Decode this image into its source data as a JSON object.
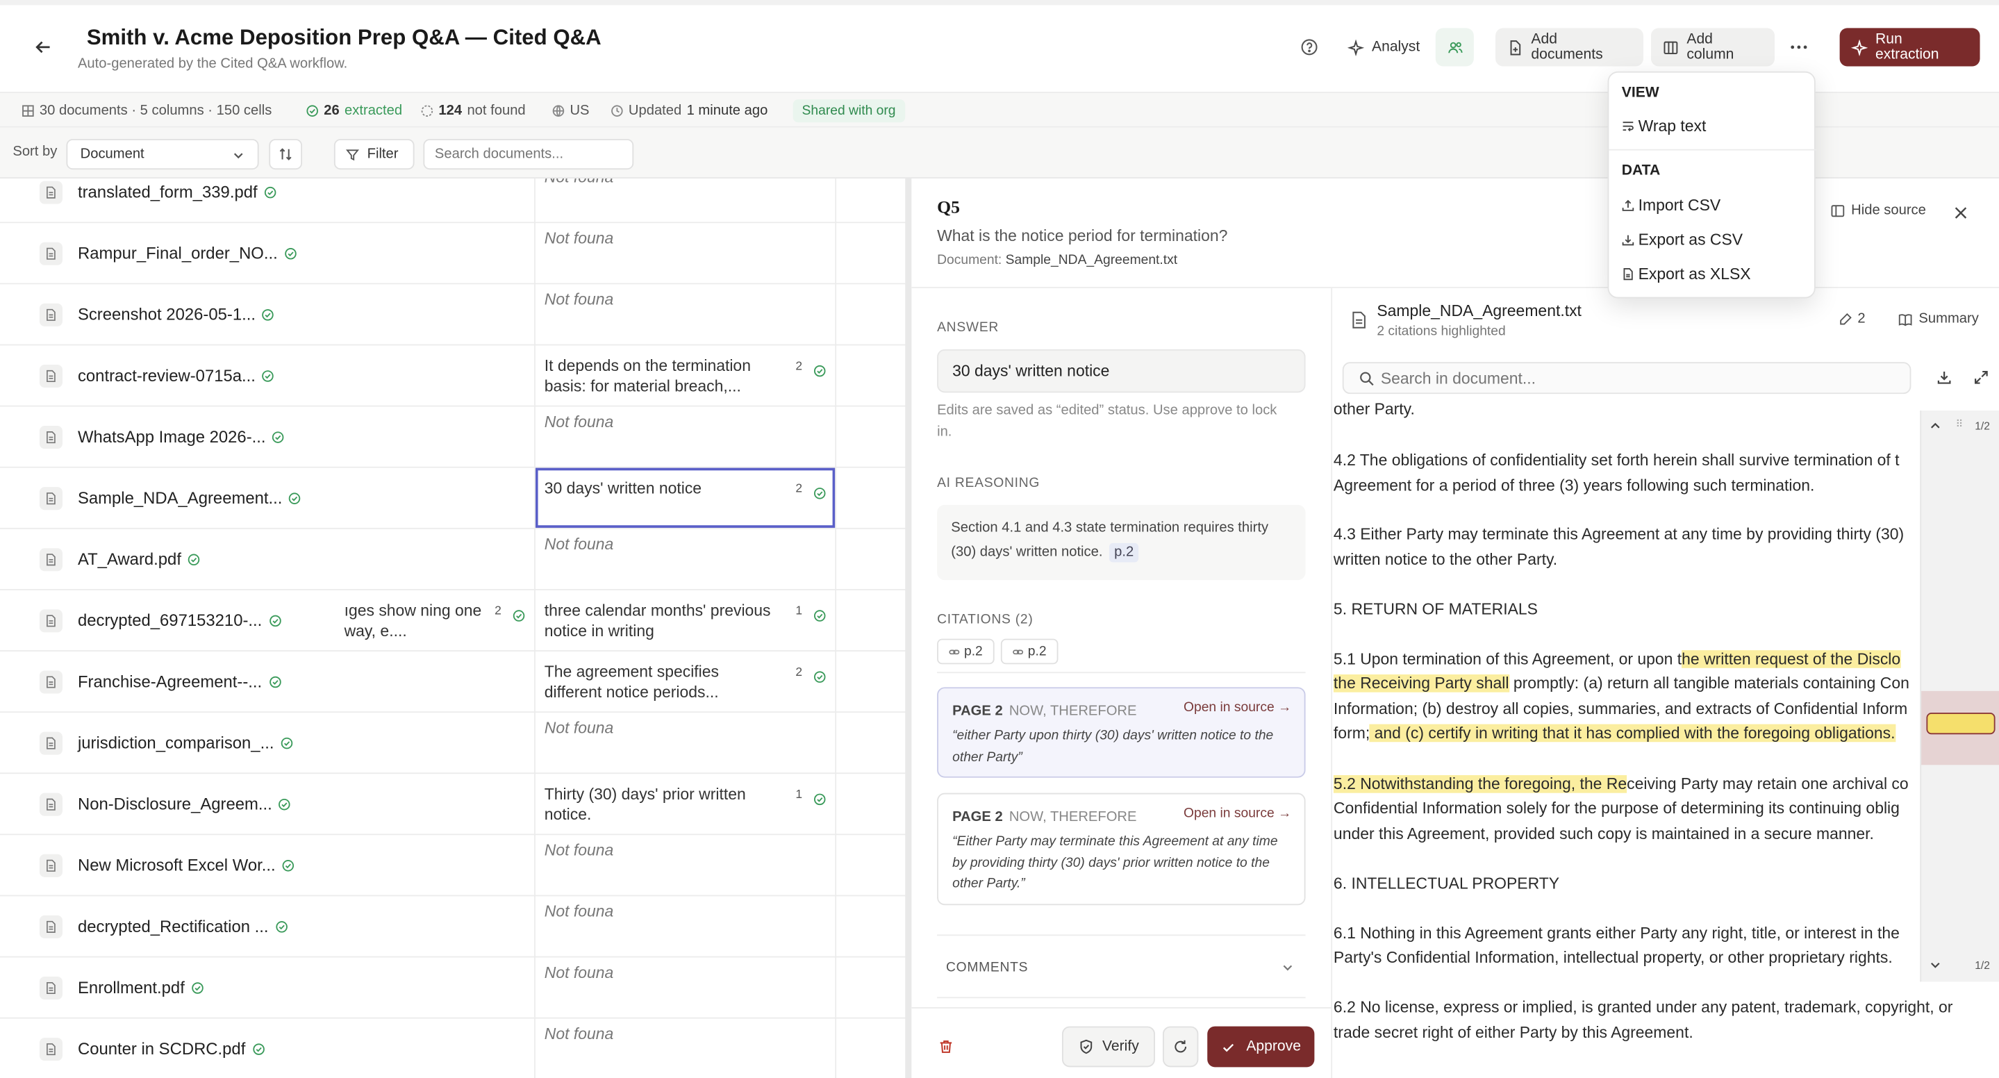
{
  "header": {
    "title": "Smith v. Acme Deposition Prep Q&A — Cited Q&A",
    "subtitle": "Auto-generated by the Cited Q&A workflow.",
    "analyst_label": "Analyst",
    "add_documents_label": "Add documents",
    "add_column_label": "Add column",
    "run_label": "Run extraction"
  },
  "meta": {
    "documents": "30 documents · 5 columns · 150 cells",
    "extracted_count": "26",
    "extracted_label": "extracted",
    "notfound_count": "124",
    "notfound_label": "not found",
    "region": "US",
    "updated_prefix": "Updated",
    "updated_value": "1 minute ago",
    "shared": "Shared with org"
  },
  "sortbar": {
    "sort_label": "Sort by",
    "sort_value": "Document",
    "filter_label": "Filter",
    "search_placeholder": "Search documents..."
  },
  "rows": [
    {
      "name": "translated_form_339.pdf",
      "cell": "Not founa",
      "nf": true
    },
    {
      "name": "Rampur_Final_order_NO...",
      "cell": "Not founa",
      "nf": true
    },
    {
      "name": "Screenshot 2026-05-1...",
      "cell": "Not founa",
      "nf": true
    },
    {
      "name": "contract-review-0715a...",
      "cell": "It depends on the termination basis: for material breach,...",
      "nf": false,
      "count": "2"
    },
    {
      "name": "WhatsApp Image 2026-...",
      "cell": "Not founa",
      "nf": true
    },
    {
      "name": "Sample_NDA_Agreement...",
      "cell": "30 days' written notice",
      "nf": false,
      "count": "2",
      "selected": true
    },
    {
      "name": "AT_Award.pdf",
      "cell": "Not founa",
      "nf": true
    },
    {
      "name": "decrypted_697153210-...",
      "cell": "three calendar months' previous notice in writing",
      "nf": false,
      "count": "1",
      "prev": "ıges show ning one way, e....",
      "prevcount": "2"
    },
    {
      "name": "Franchise-Agreement--...",
      "cell": "The agreement specifies different notice periods...",
      "nf": false,
      "count": "2"
    },
    {
      "name": "jurisdiction_comparison_...",
      "cell": "Not founa",
      "nf": true
    },
    {
      "name": "Non-Disclosure_Agreem...",
      "cell": "Thirty (30) days' prior written notice.",
      "nf": false,
      "count": "1"
    },
    {
      "name": "New Microsoft Excel Wor...",
      "cell": "Not founa",
      "nf": true
    },
    {
      "name": "decrypted_Rectification ...",
      "cell": "Not founa",
      "nf": true
    },
    {
      "name": "Enrollment.pdf",
      "cell": "Not founa",
      "nf": true
    },
    {
      "name": "Counter in SCDRC.pdf",
      "cell": "Not founa",
      "nf": true
    }
  ],
  "panel": {
    "qid": "Q5",
    "question": "What is the notice period for termination?",
    "doc_prefix": "Document:",
    "doc_name": "Sample_NDA_Agreement.txt",
    "hide_source": "Hide source",
    "answer_label": "ANSWER",
    "answer": "30 days' written notice",
    "answer_hint": "Edits are saved as “edited” status. Use approve to lock in.",
    "reasoning_label": "AI REASONING",
    "reasoning": "Section 4.1 and 4.3 state termination requires thirty (30) days' written notice.",
    "reasoning_ref": "p.2",
    "citations_label": "CITATIONS (2)",
    "chips": [
      "p.2",
      "p.2"
    ],
    "citations": [
      {
        "page": "PAGE 2",
        "section": "NOW, THEREFORE",
        "open": "Open in source →",
        "quote": "“either Party upon thirty (30) days' written notice to the other Party”"
      },
      {
        "page": "PAGE 2",
        "section": "NOW, THEREFORE",
        "open": "Open in source →",
        "quote": "“Either Party may terminate this Agreement at any time by providing thirty (30) days' prior written notice to the other Party.”"
      }
    ],
    "comments_label": "COMMENTS",
    "verify": "Verify",
    "approve": "Approve"
  },
  "viewer": {
    "filename": "Sample_NDA_Agreement.txt",
    "subtitle": "2 citations highlighted",
    "cite_count": "2",
    "summary": "Summary",
    "search_placeholder": "Search in document...",
    "page_top": "1/2",
    "page_bottom": "1/2",
    "lines": {
      "l0": "other Party.",
      "l1": "4.2 The obligations of confidentiality set forth herein shall survive termination of t",
      "l2": "Agreement for a period of three (3) years following such termination.",
      "l3": "4.3 Either Party may terminate this Agreement at any time by providing thirty (30)",
      "l4": "written notice to the other Party.",
      "l5": "5. RETURN OF MATERIALS",
      "l6a": "5.1 Upon termination of this Agreement, or upon t",
      "l6b": "he written request of the Disclo",
      "l7a": "the Receiving Party shall",
      "l7b": " promptly: (a) return all tangible materials containing Con",
      "l8": "Information; (b) destroy all copies, summaries, and extracts of Confidential Inform",
      "l9a": "form;",
      "l9b": " and (c) certify in writing that it has complied with the foregoing obligations.",
      "l10a": "5.2 Notwithstanding the foregoing, the Re",
      "l10b": "ceiving Party may retain one archival co",
      "l11": "Confidential Information solely for the purpose of determining its continuing oblig",
      "l12": "under this Agreement, provided such copy is maintained in a secure manner.",
      "l13": "6. INTELLECTUAL PROPERTY",
      "l14": "6.1 Nothing in this Agreement grants either Party any right, title, or interest in the",
      "l15": "Party's Confidential Information, intellectual property, or other proprietary rights.",
      "l16": "6.2 No license, express or implied, is granted under any patent, trademark, copyright, or",
      "l17": "trade secret right of either Party by this Agreement."
    }
  },
  "menu": {
    "view_label": "VIEW",
    "wrap": "Wrap text",
    "data_label": "DATA",
    "import": "Import CSV",
    "export_csv": "Export as CSV",
    "export_xlsx": "Export as XLSX"
  },
  "colors": {
    "accent": "#7a2b2b",
    "highlight": "#fbeea0",
    "selected_border": "#5a5fc8",
    "green": "#3a9a5a"
  }
}
